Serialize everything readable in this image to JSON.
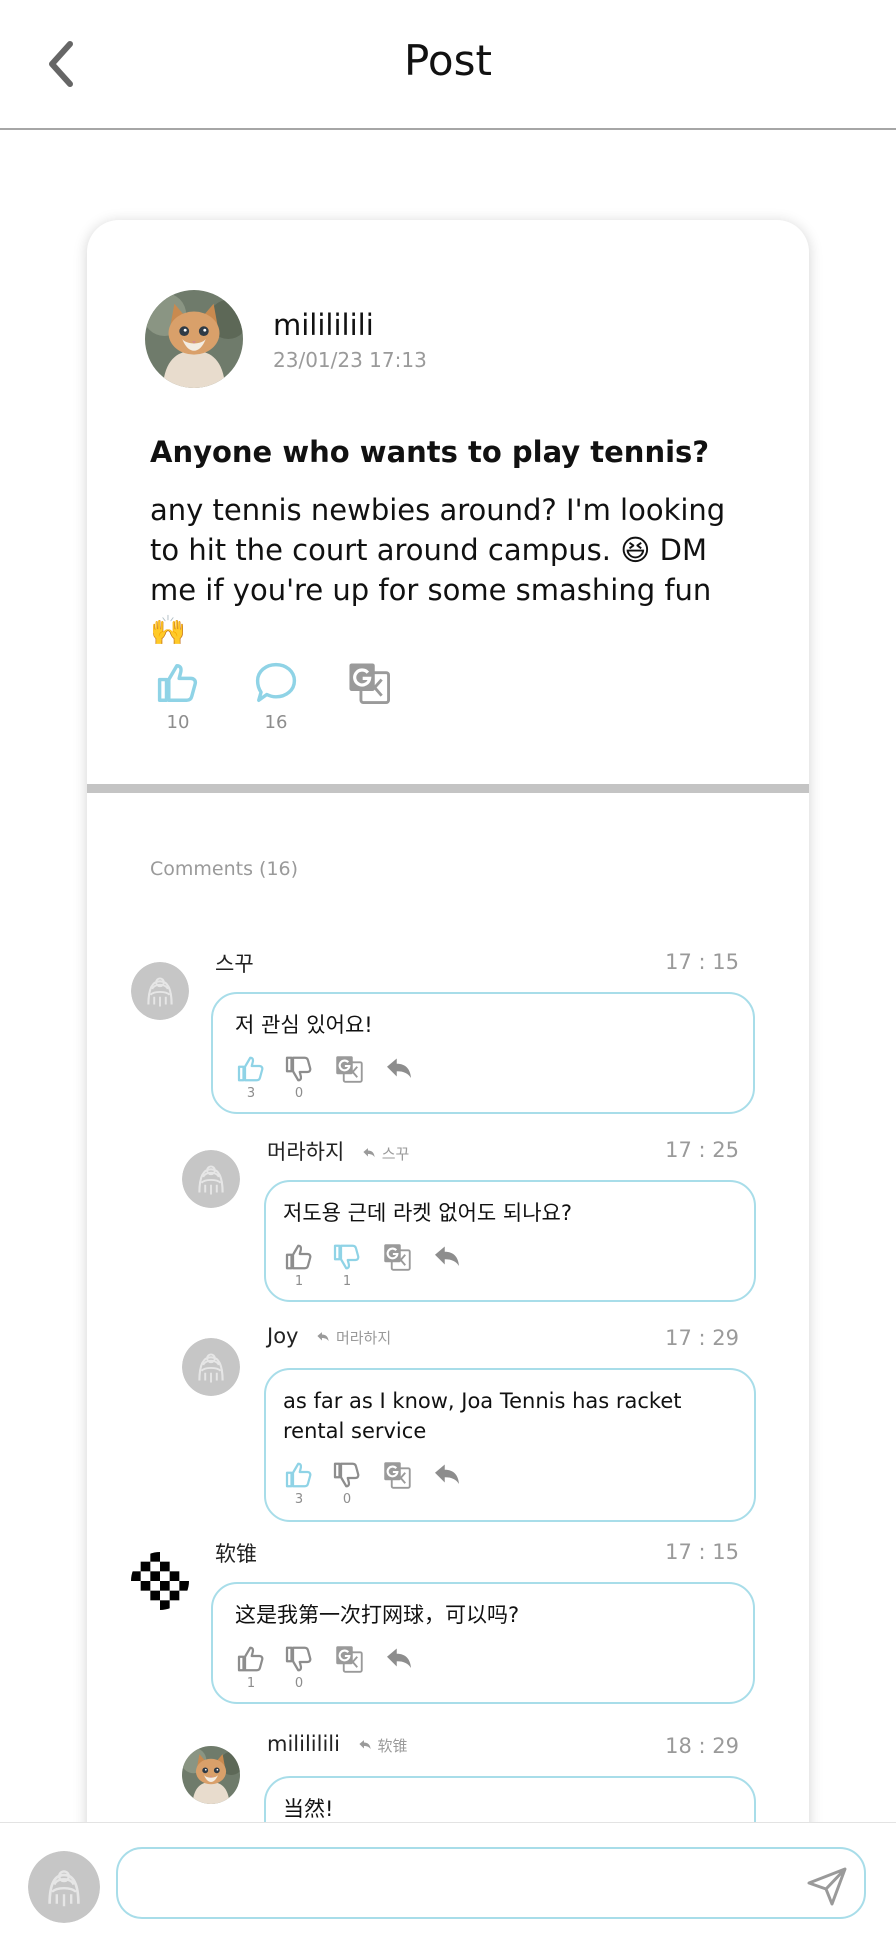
{
  "header": {
    "title": "Post"
  },
  "post": {
    "author": "milililili",
    "date": "23/01/23 17:13",
    "title": "Anyone who wants to play tennis?",
    "body": "any tennis newbies around? I'm looking to hit the court around campus. 😆 DM me if you're up for some smashing fun 🙌",
    "likes": "10",
    "comments": "16"
  },
  "comments_label": "Comments (16)",
  "comments": [
    {
      "name": "스꾸",
      "reply_to": "",
      "time": "17 : 15",
      "text": "저 관심 있어요!",
      "likes": "3",
      "dislikes": "0",
      "liked": true,
      "disliked": false
    },
    {
      "name": "머라하지",
      "reply_to": "스꾸",
      "time": "17 : 25",
      "text": "저도용 근데 라켓 없어도 되나요?",
      "likes": "1",
      "dislikes": "1",
      "liked": false,
      "disliked": true
    },
    {
      "name": "Joy",
      "reply_to": "머라하지",
      "time": "17 : 29",
      "text": "as far as I know, Joa Tennis has racket rental service",
      "likes": "3",
      "dislikes": "0",
      "liked": true,
      "disliked": false
    },
    {
      "name": "软锥",
      "reply_to": "",
      "time": "17 : 15",
      "text": "这是我第一次打网球，可以吗?",
      "likes": "1",
      "dislikes": "0",
      "liked": false,
      "disliked": false
    },
    {
      "name": "milililili",
      "reply_to": "软锥",
      "time": "18 : 29",
      "text": "当然!"
    }
  ],
  "colors": {
    "accent": "#8fd3e6",
    "bubble_border": "#a8dde9",
    "icon_gray": "#8d8d8d",
    "divider": "#c4c4c4"
  },
  "icons": [
    "back-chevron",
    "thumbs-up",
    "thumbs-down",
    "comment",
    "translate",
    "reply",
    "send"
  ]
}
